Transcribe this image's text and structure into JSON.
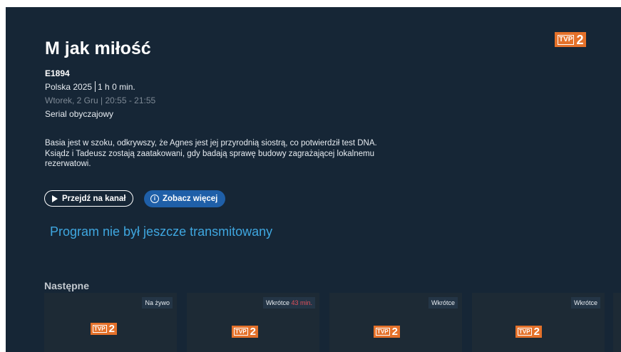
{
  "channel": {
    "logo_text": "TVP",
    "logo_number": "2",
    "logo_icon": "tvp2-logo",
    "logo_color": "#e4712a"
  },
  "program": {
    "title": "M jak miłość",
    "episode": "E1894",
    "origin_year": "Polska 2025",
    "duration": "1 h 0 min.",
    "airtime": "Wtorek, 2 Gru | 20:55 - 21:55",
    "genre": "Serial obyczajowy",
    "description": "Basia jest w szoku, odkrywszy, że Agnes jest jej przyrodnią siostrą, co potwierdził test DNA. Ksiądz i Tadeusz zostają zaatakowani, gdy badają sprawę budowy zagrażającej lokalnemu rezerwatowi."
  },
  "actions": {
    "go_to_channel": "Przejdź na kanał",
    "see_more": "Zobacz więcej"
  },
  "notice": "Program nie był jeszcze transmitowany",
  "next": {
    "heading": "Następne",
    "cards": [
      {
        "badge": "Na żywo",
        "badge_extra": ""
      },
      {
        "badge": "Wkrótce",
        "badge_extra": "43 min."
      },
      {
        "badge": "Wkrótce",
        "badge_extra": ""
      },
      {
        "badge": "Wkrótce",
        "badge_extra": ""
      }
    ]
  },
  "colors": {
    "background": "#162636",
    "accent": "#1f5fa8",
    "notice": "#3fa7e0",
    "badge_highlight": "#e0505a"
  }
}
